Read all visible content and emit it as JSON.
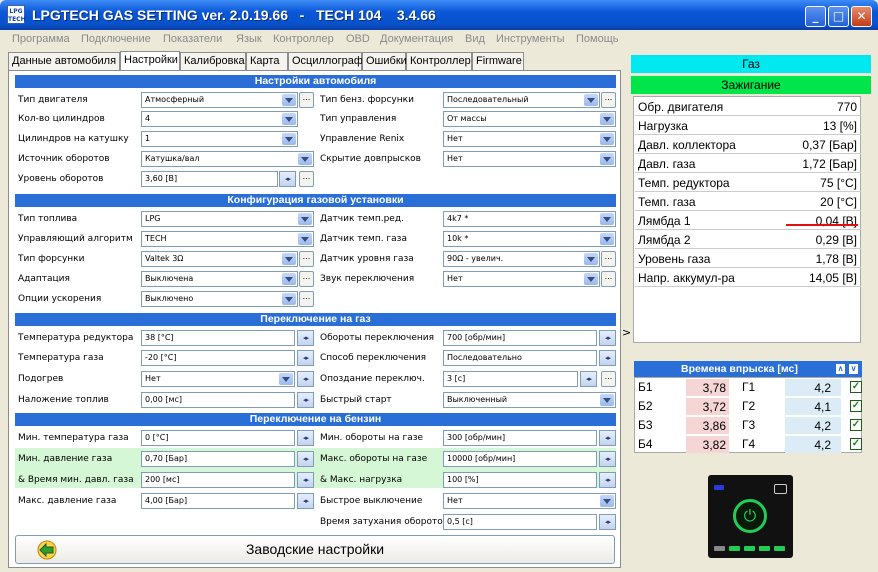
{
  "window": {
    "logo": "LPG\nTECH",
    "title": "LPGTECH GAS SETTING ver. 2.0.19.66   -   TECH 104    3.4.66",
    "minimize": "_",
    "maximize": "□",
    "close": "✕"
  },
  "menu": [
    "Программа",
    "Подключение",
    "Показатели",
    "Язык",
    "Контроллер",
    "OBD",
    "Документация",
    "Вид",
    "Инструменты",
    "Помощь"
  ],
  "tabs": [
    "Данные автомобиля",
    "Настройки",
    "Калибровка",
    "Карта",
    "Осциллограф",
    "Ошибки",
    "Контроллер",
    "Firmware"
  ],
  "active_tab": "Настройки",
  "sections": {
    "car": "Настройки автомобиля",
    "gas_config": "Конфигурация газовой установки",
    "to_gas": "Переключение на газ",
    "to_petrol": "Переключение на бензин"
  },
  "car": {
    "engine_type": {
      "label": "Тип двигателя",
      "value": "Атмосферный"
    },
    "cylinders": {
      "label": "Кол-во цилиндров",
      "value": "4"
    },
    "cyl_per_coil": {
      "label": "Цилиндров на катушку",
      "value": "1"
    },
    "rpm_source": {
      "label": "Источник оборотов",
      "value": "Катушка/вал"
    },
    "rpm_level": {
      "label": "Уровень оборотов",
      "value": "3,60 [В]"
    },
    "petrol_injector_type": {
      "label": "Тип бенз. форсунки",
      "value": "Последовательный"
    },
    "control_type": {
      "label": "Тип управления",
      "value": "От массы"
    },
    "renix": {
      "label": "Управление Renix",
      "value": "Нет"
    },
    "hide_injections": {
      "label": "Скрытие довпрысков",
      "value": "Нет"
    }
  },
  "gas_config": {
    "fuel_type": {
      "label": "Тип топлива",
      "value": "LPG"
    },
    "algorithm": {
      "label": "Управляющий алгоритм",
      "value": "TECH"
    },
    "injector_type": {
      "label": "Тип форсунки",
      "value": "Valtek 3Ω"
    },
    "adaptation": {
      "label": "Адаптация",
      "value": "Выключена"
    },
    "accel_options": {
      "label": "Опции ускорения",
      "value": "Выключено"
    },
    "reducer_temp_sensor": {
      "label": "Датчик темп.ред.",
      "value": "4k7 *"
    },
    "gas_temp_sensor": {
      "label": "Датчик темп. газа",
      "value": "10k *"
    },
    "gas_level_sensor": {
      "label": "Датчик уровня газа",
      "value": "90Ω - увелич."
    },
    "switch_sound": {
      "label": "Звук переключения",
      "value": "Нет"
    }
  },
  "to_gas": {
    "reducer_temp": {
      "label": "Температура редуктора",
      "value": "38 [°C]"
    },
    "gas_temp": {
      "label": "Температура газа",
      "value": "-20 [°C]"
    },
    "heating": {
      "label": "Подогрев",
      "value": "Нет"
    },
    "fuel_overlap": {
      "label": "Наложение топлив",
      "value": "0,00 [мс]"
    },
    "switch_rpm": {
      "label": "Обороты переключения",
      "value": "700 [обр/мин]"
    },
    "switch_method": {
      "label": "Способ переключения",
      "value": "Последовательно"
    },
    "switch_delay": {
      "label": "Опоздание переключ.",
      "value": "3 [с]"
    },
    "quick_start": {
      "label": "Быстрый старт",
      "value": "Выключенный"
    }
  },
  "to_petrol": {
    "min_gas_temp": {
      "label": "Мин. температура газа",
      "value": "0 [°C]"
    },
    "min_gas_pressure": {
      "label": "Мин. давление газа",
      "value": "0,70 [Бар]"
    },
    "min_pressure_time": {
      "label": "& Время мин. давл. газа",
      "value": "200 [мс]"
    },
    "max_gas_pressure": {
      "label": "Макс. давление газа",
      "value": "4,00 [Бар]"
    },
    "min_rpm_gas": {
      "label": "Мин. обороты на газе",
      "value": "300 [обр/мин]"
    },
    "max_rpm_gas": {
      "label": "Макс. обороты на газе",
      "value": "10000 [обр/мин]"
    },
    "max_load": {
      "label": "& Макс. нагрузка",
      "value": "100 [%]"
    },
    "fast_off": {
      "label": "Быстрое выключение",
      "value": "Нет"
    },
    "rpm_decay_time": {
      "label": "Время затухания оборотов",
      "value": "0,5 [с]"
    }
  },
  "factory_button": "Заводские настройки",
  "collapse_arrow": ">",
  "status": {
    "gas": "Газ",
    "ignition": "Зажигание",
    "gas_color": "#00e8f0",
    "ignition_color": "#00e64a"
  },
  "params": [
    {
      "name": "Обр. двигателя",
      "value": "770"
    },
    {
      "name": "Нагрузка",
      "value": "13 [%]"
    },
    {
      "name": "Давл. коллектора",
      "value": "0,37 [Бар]"
    },
    {
      "name": "Давл. газа",
      "value": "1,72 [Бар]"
    },
    {
      "name": "Темп. редуктора",
      "value": "75 [°C]"
    },
    {
      "name": "Темп. газа",
      "value": "20 [°C]"
    },
    {
      "name": "Лямбда 1",
      "value": "0,04 [В]"
    },
    {
      "name": "Лямбда 2",
      "value": "0,29 [В]"
    },
    {
      "name": "Уровень газа",
      "value": "1,78 [В]"
    },
    {
      "name": "Напр. аккумул-ра",
      "value": "14,05 [В]"
    }
  ],
  "injection": {
    "header": "Времена впрыска [мс]",
    "rows": [
      {
        "b": "Б1",
        "bv": "3,78",
        "g": "Г1",
        "gv": "4,2"
      },
      {
        "b": "Б2",
        "bv": "3,72",
        "g": "Г2",
        "gv": "4,1"
      },
      {
        "b": "Б3",
        "bv": "3,86",
        "g": "Г3",
        "gv": "4,2"
      },
      {
        "b": "Б4",
        "bv": "3,82",
        "g": "Г4",
        "gv": "4,2"
      }
    ]
  }
}
